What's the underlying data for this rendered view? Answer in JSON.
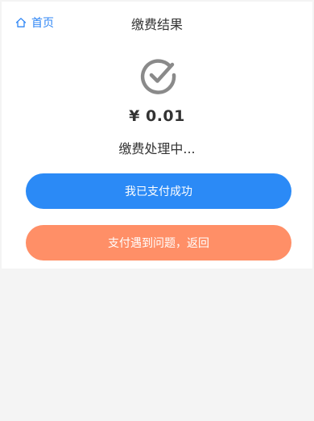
{
  "header": {
    "home_label": "首页",
    "home_icon": "home-icon",
    "title": "缴费结果"
  },
  "result": {
    "status_icon": "check-circle-icon",
    "amount": "¥ 0.01",
    "status_text": "缴费处理中..."
  },
  "actions": {
    "confirm_label": "我已支付成功",
    "problem_label": "支付遇到问题，返回"
  },
  "colors": {
    "primary": "#2b8af6",
    "secondary": "#ff8f67",
    "link": "#2f86f5",
    "icon_gray": "#8a8a8a"
  }
}
